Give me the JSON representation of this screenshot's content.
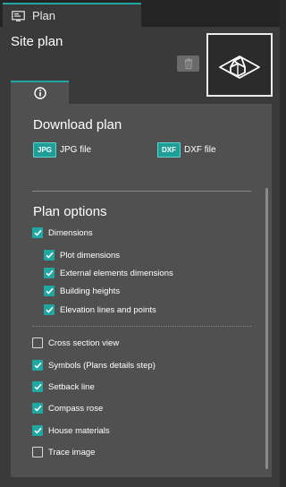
{
  "tab": {
    "label": "Plan"
  },
  "site": {
    "title": "Site plan"
  },
  "download": {
    "title": "Download plan",
    "items": [
      {
        "badge": "JPG",
        "label": "JPG file"
      },
      {
        "badge": "DXF",
        "label": "DXF file"
      }
    ]
  },
  "options": {
    "title": "Plan options",
    "dimensions": {
      "label": "Dimensions",
      "checked": true
    },
    "sub": [
      {
        "label": "Plot dimensions",
        "checked": true
      },
      {
        "label": "External elements dimensions",
        "checked": true
      },
      {
        "label": "Building heights",
        "checked": true
      },
      {
        "label": "Elevation lines and points",
        "checked": true
      }
    ],
    "others": [
      {
        "label": "Cross section view",
        "checked": false
      },
      {
        "label": "Symbols (Plans details step)",
        "checked": true
      },
      {
        "label": "Setback line",
        "checked": true
      },
      {
        "label": "Compass rose",
        "checked": true
      },
      {
        "label": "House materials",
        "checked": true
      },
      {
        "label": "Trace image",
        "checked": false
      }
    ]
  },
  "colors": {
    "accent": "#21a7a1",
    "panel": "#3a3a3a",
    "content": "#505050"
  },
  "icons": {
    "tab": "screen-icon",
    "delete": "trash-icon",
    "info": "info-icon",
    "thumbnail": "house-3d-icon",
    "check": "checkmark-icon"
  }
}
